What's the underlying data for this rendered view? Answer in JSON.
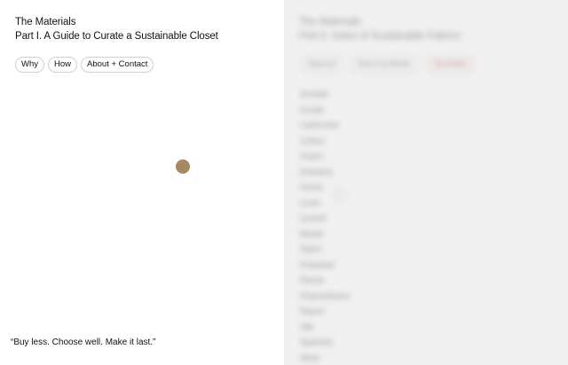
{
  "header": {
    "title": "The Materials",
    "subtitle": "Part I. A Guide to Curate a Sustainable Closet"
  },
  "nav": {
    "items": [
      "Why",
      "How",
      "About + Contact"
    ]
  },
  "material_dot": {
    "color": "#a88765"
  },
  "quote": "“Buy less. Choose well. Make it last.”",
  "colors": {
    "dot": "#a88765",
    "right_panel_bg": "#f0f0f0",
    "blurred_selected_pill": "#c98a8a"
  }
}
